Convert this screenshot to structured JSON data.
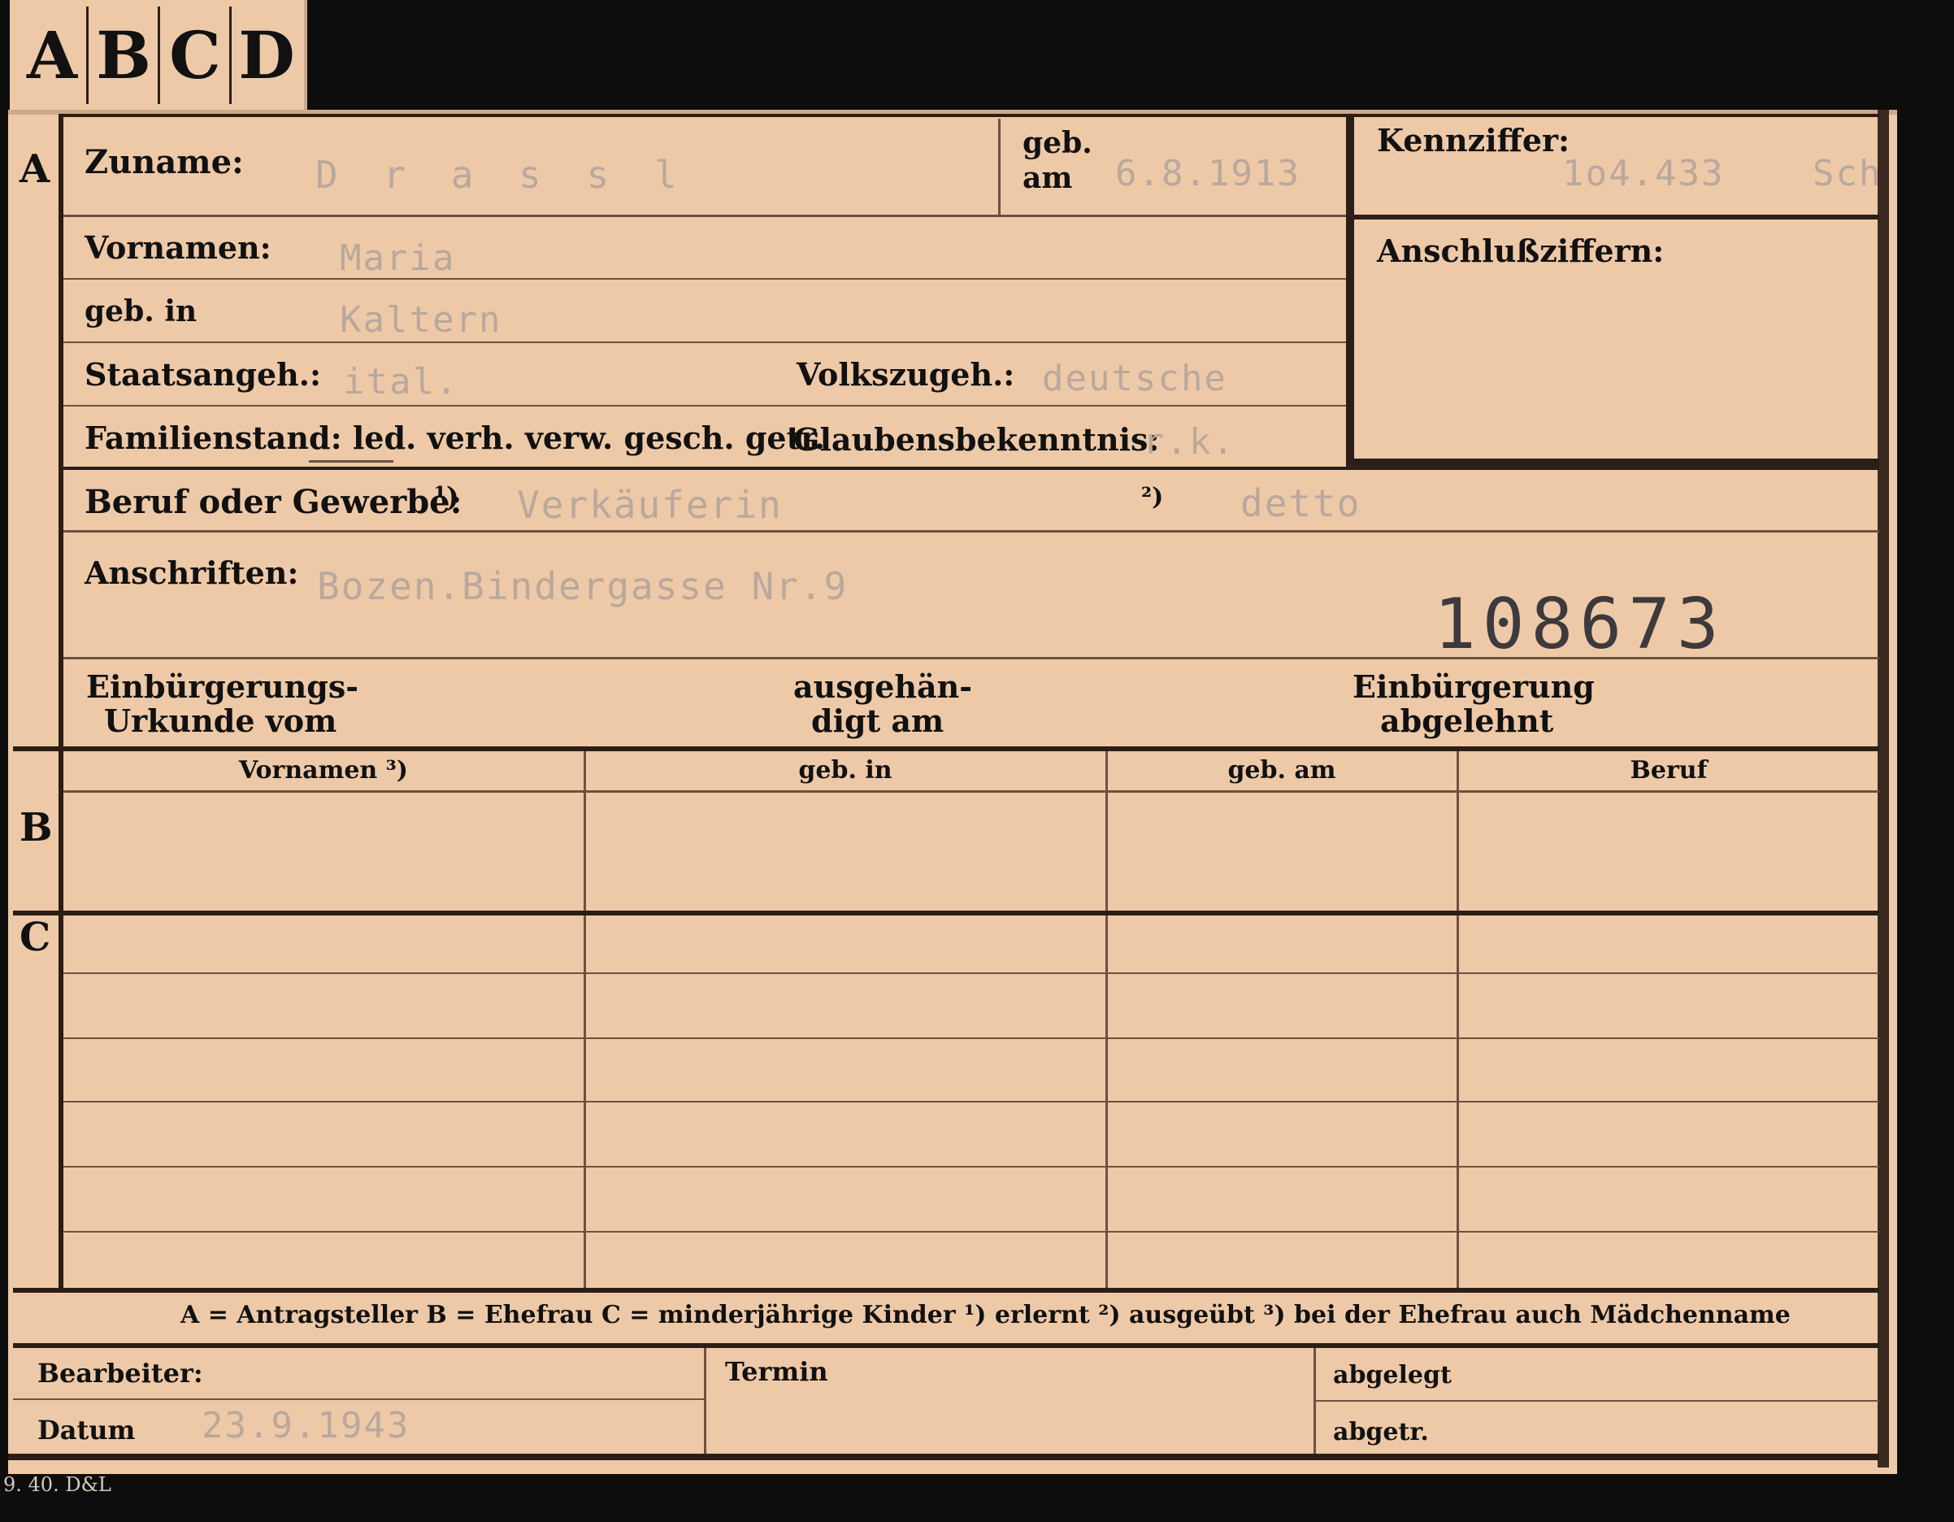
{
  "tab_letters": [
    "A",
    "B",
    "C",
    "D"
  ],
  "sections": {
    "a": "A",
    "b": "B",
    "c": "C"
  },
  "form": {
    "zuname_label": "Zuname:",
    "zuname_value": "D r a s s l",
    "geb_label": "geb.",
    "am_label": "am",
    "geb_am_value": "6.8.1913",
    "kennziffer_label": "Kennziffer:",
    "kennziffer_value": "1o4.433",
    "kennziffer_suffix": "Sch",
    "anschlussziffern_label": "Anschlußziffern:",
    "vornamen_label": "Vornamen:",
    "vornamen_value": "Maria",
    "geb_in_label": "geb. in",
    "geb_in_value": "Kaltern",
    "staatsangeh_label": "Staatsangeh.:",
    "staatsangeh_value": "ital.",
    "volkszugeh_label": "Volkszugeh.:",
    "volkszugeh_value": "deutsche",
    "familienstand_label": "Familienstand: led. verh. verw. gesch. getr.",
    "glaubensbekenntnis_label": "Glaubensbekenntnis:",
    "glaubensbekenntnis_value": "r.k.",
    "beruf_label": "Beruf oder Gewerbe:",
    "beruf_note1": "¹)",
    "beruf_value1": "Verkäuferin",
    "beruf_note2": "²)",
    "beruf_value2": "detto",
    "anschriften_label": "Anschriften:",
    "anschriften_value": "Bozen.Bindergasse Nr.9",
    "stamp_number": "108673",
    "einbuergerung_urkunde_l1": "Einbürgerungs-",
    "einbuergerung_urkunde_l2": "Urkunde vom",
    "ausgehaendigt_l1": "ausgehän-",
    "ausgehaendigt_l2": "digt am",
    "einbuergerung_abgelehnt_l1": "Einbürgerung",
    "einbuergerung_abgelehnt_l2": "abgelehnt"
  },
  "table": {
    "headers": [
      "Vornamen ³)",
      "geb. in",
      "geb. am",
      "Beruf"
    ]
  },
  "legend": "A = Antragsteller   B = Ehefrau   C = minderjährige Kinder   ¹) erlernt   ²) ausgeübt   ³) bei der Ehefrau auch Mädchenname",
  "bottom": {
    "bearbeiter_label": "Bearbeiter:",
    "datum_label": "Datum",
    "datum_value": "23.9.1943",
    "termin_label": "Termin",
    "abgelegt_label": "abgelegt",
    "abgetr_label": "abgetr."
  },
  "print_code": "9. 40. D&L",
  "colors": {
    "card": "#eec9a8",
    "ink": "#111111",
    "typed": "#b9a89c",
    "stamp": "#3d3a3d"
  }
}
